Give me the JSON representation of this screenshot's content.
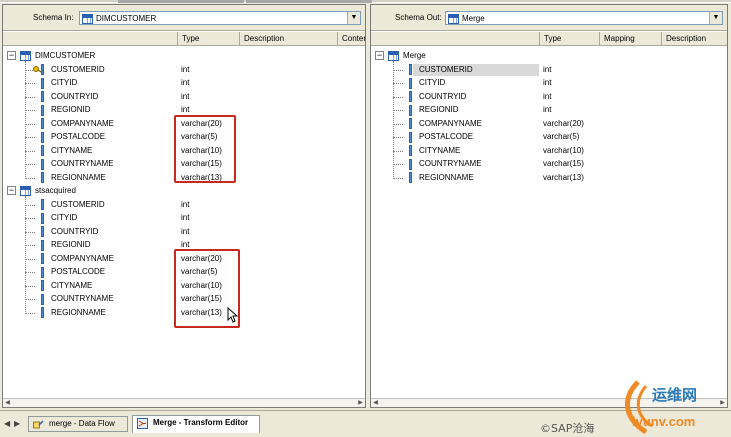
{
  "left_pane": {
    "schema_label": "Schema In:",
    "schema_value": "DIMCUSTOMER",
    "columns": [
      "",
      "Type",
      "Description",
      "Conter"
    ],
    "tables": [
      {
        "name": "DIMCUSTOMER",
        "fields": [
          {
            "name": "CUSTOMERID",
            "type": "int",
            "key": true
          },
          {
            "name": "CITYID",
            "type": "int"
          },
          {
            "name": "COUNTRYID",
            "type": "int"
          },
          {
            "name": "REGIONID",
            "type": "int"
          },
          {
            "name": "COMPANYNAME",
            "type": "varchar(20)"
          },
          {
            "name": "POSTALCODE",
            "type": "varchar(5)"
          },
          {
            "name": "CITYNAME",
            "type": "varchar(10)"
          },
          {
            "name": "COUNTRYNAME",
            "type": "varchar(15)"
          },
          {
            "name": "REGIONNAME",
            "type": "varchar(13)"
          }
        ]
      },
      {
        "name": "stsacquired",
        "fields": [
          {
            "name": "CUSTOMERID",
            "type": "int"
          },
          {
            "name": "CITYID",
            "type": "int"
          },
          {
            "name": "COUNTRYID",
            "type": "int"
          },
          {
            "name": "REGIONID",
            "type": "int"
          },
          {
            "name": "COMPANYNAME",
            "type": "varchar(20)"
          },
          {
            "name": "POSTALCODE",
            "type": "varchar(5)"
          },
          {
            "name": "CITYNAME",
            "type": "varchar(10)"
          },
          {
            "name": "COUNTRYNAME",
            "type": "varchar(15)"
          },
          {
            "name": "REGIONNAME",
            "type": "varchar(13)"
          }
        ]
      }
    ]
  },
  "right_pane": {
    "schema_label": "Schema Out:",
    "schema_value": "Merge",
    "columns": [
      "",
      "Type",
      "Mapping",
      "Description"
    ],
    "table": {
      "name": "Merge",
      "fields": [
        {
          "name": "CUSTOMERID",
          "type": "int",
          "selected": true
        },
        {
          "name": "CITYID",
          "type": "int"
        },
        {
          "name": "COUNTRYID",
          "type": "int"
        },
        {
          "name": "REGIONID",
          "type": "int"
        },
        {
          "name": "COMPANYNAME",
          "type": "varchar(20)"
        },
        {
          "name": "POSTALCODE",
          "type": "varchar(5)"
        },
        {
          "name": "CITYNAME",
          "type": "varchar(10)"
        },
        {
          "name": "COUNTRYNAME",
          "type": "varchar(15)"
        },
        {
          "name": "REGIONNAME",
          "type": "varchar(13)"
        }
      ]
    }
  },
  "tabs": [
    {
      "label": "merge - Data Flow",
      "active": false,
      "icon": "dataflow-icon"
    },
    {
      "label": "Merge - Transform Editor",
      "active": true,
      "icon": "transform-icon"
    }
  ],
  "watermark": {
    "site_cn": "运维网",
    "site_en": "iyunv.com",
    "credit": "©SAP沧海"
  },
  "colors": {
    "highlight_box": "#c8281e",
    "selected_row": "#d9d9d9",
    "watermark_orange": "#f08a24"
  }
}
